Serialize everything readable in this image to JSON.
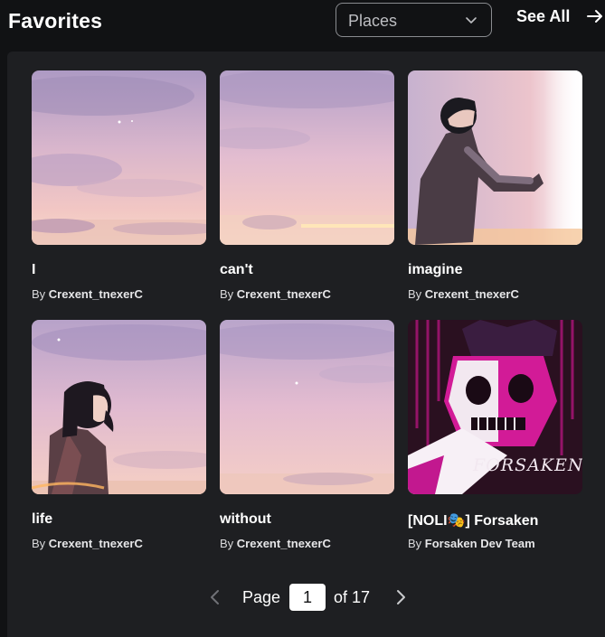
{
  "header": {
    "title": "Favorites",
    "filter_selected": "Places",
    "see_all_label": "See All"
  },
  "items": [
    {
      "title": "I",
      "by": "By",
      "creator": "Crexent_tnexerC"
    },
    {
      "title": "can't",
      "by": "By",
      "creator": "Crexent_tnexerC"
    },
    {
      "title": "imagine",
      "by": "By",
      "creator": "Crexent_tnexerC"
    },
    {
      "title": "life",
      "by": "By",
      "creator": "Crexent_tnexerC"
    },
    {
      "title": "without",
      "by": "By",
      "creator": "Crexent_tnexerC"
    },
    {
      "title": "[NOLI🎭] Forsaken",
      "by": "By",
      "creator": "Forsaken Dev Team"
    }
  ],
  "pagination": {
    "page_label": "Page",
    "current_page": "1",
    "of_label": "of 17"
  },
  "thumbnail_text": {
    "forsaken_logo": "FORSAKEN"
  },
  "colors": {
    "background": "#111214",
    "panel": "#1e1f22",
    "sky_top": "#b8a2c8",
    "sky_bottom": "#f3c9c6",
    "forsaken_magenta": "#c2188f"
  }
}
